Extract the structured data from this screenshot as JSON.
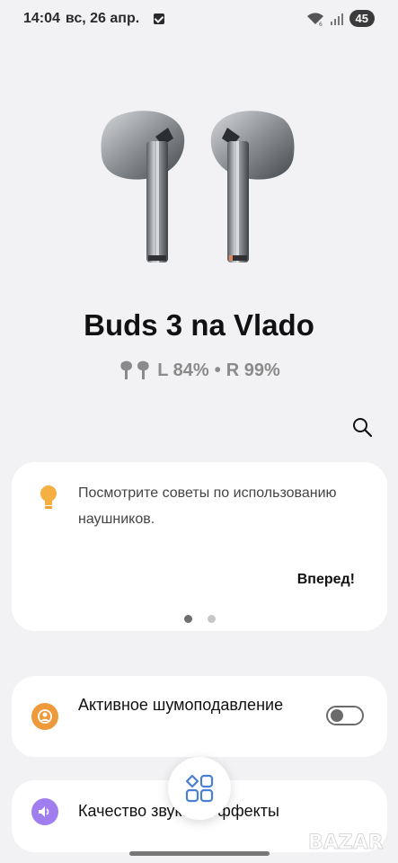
{
  "status_bar": {
    "time": "14:04",
    "date": "вс, 26 апр.",
    "battery": "45"
  },
  "device": {
    "name": "Buds 3 na Vlado",
    "battery_left": "L 84%",
    "separator": "•",
    "battery_right": "R 99%"
  },
  "tips": {
    "text": "Посмотрите советы по использованию наушников.",
    "action": "Вперед!",
    "pages": 2,
    "active_page": 0
  },
  "settings": {
    "anc_label": "Активное шумоподавление",
    "anc_enabled": false,
    "sound_label": "Качество звука и эффекты"
  },
  "colors": {
    "anc_icon_bg": "#ef9a3a",
    "sound_icon_bg": "#a07ef0",
    "tip_bulb": "#f5b041",
    "fab_icon": "#4a7fd4"
  },
  "icons": {
    "search": "search-icon",
    "tips": "lightbulb-icon",
    "anc": "anc-icon",
    "sound": "volume-icon",
    "fab": "apps-grid-icon"
  }
}
